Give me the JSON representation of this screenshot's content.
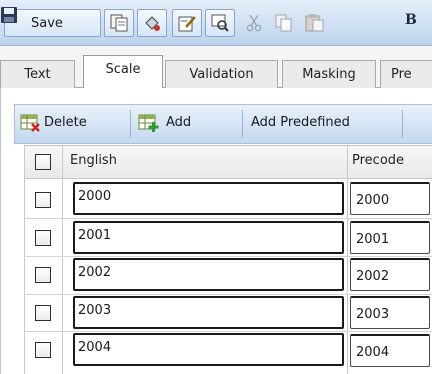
{
  "toolbar": {
    "save_label": "Save",
    "icons": [
      "save-icon",
      "copy-page-icon",
      "fill-icon",
      "edit-icon",
      "preview-icon",
      "cut-icon",
      "copy-icon",
      "paste-icon",
      "bold-icon"
    ],
    "bold_label": "B"
  },
  "tabs": [
    {
      "label": "Text",
      "active": false
    },
    {
      "label": "Scale",
      "active": true
    },
    {
      "label": "Validation",
      "active": false
    },
    {
      "label": "Masking",
      "active": false
    },
    {
      "label": "Pre",
      "active": false
    }
  ],
  "actions": {
    "delete_label": "Delete",
    "add_label": "Add",
    "add_predefined_label": "Add Predefined"
  },
  "grid": {
    "columns": [
      "English",
      "Precode"
    ],
    "rows": [
      {
        "english": "2000",
        "precode": "2000",
        "checked": false
      },
      {
        "english": "2001",
        "precode": "2001",
        "checked": false
      },
      {
        "english": "2002",
        "precode": "2002",
        "checked": false
      },
      {
        "english": "2003",
        "precode": "2003",
        "checked": false
      },
      {
        "english": "2004",
        "precode": "2004",
        "checked": false
      }
    ]
  },
  "colors": {
    "toolbar_bg": "#cfe0f3",
    "border": "#a9a9a9",
    "input_border": "#1a1a1a"
  }
}
